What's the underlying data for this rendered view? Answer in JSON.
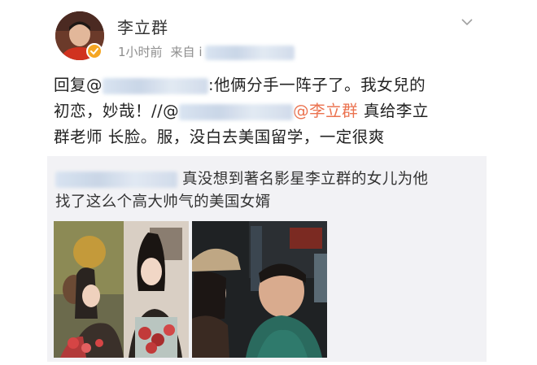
{
  "post": {
    "author": "李立群",
    "time": "1小时前",
    "source_prefix": "来自 i",
    "content": {
      "reply_prefix": "回复@",
      "reply_tail": ":他俩分手一阵子了。我女兒的",
      "line2_start": "初恋，妙哉！//@",
      "line2_mention": "@李立群",
      "line2_end": " 真给李立",
      "line3": "群老师 长脸。服，没白去美国留学，一定很爽"
    },
    "repost": {
      "line1": "真没想到著名影星李立群的女儿为他",
      "line2": "找了这么个高大帅气的美国女婿"
    }
  },
  "colors": {
    "mention": "#eb7350",
    "badge": "#f5a623",
    "repost_bg": "#f2f2f5"
  },
  "icons": [
    "chevron-down-icon",
    "verified-badge-icon"
  ]
}
